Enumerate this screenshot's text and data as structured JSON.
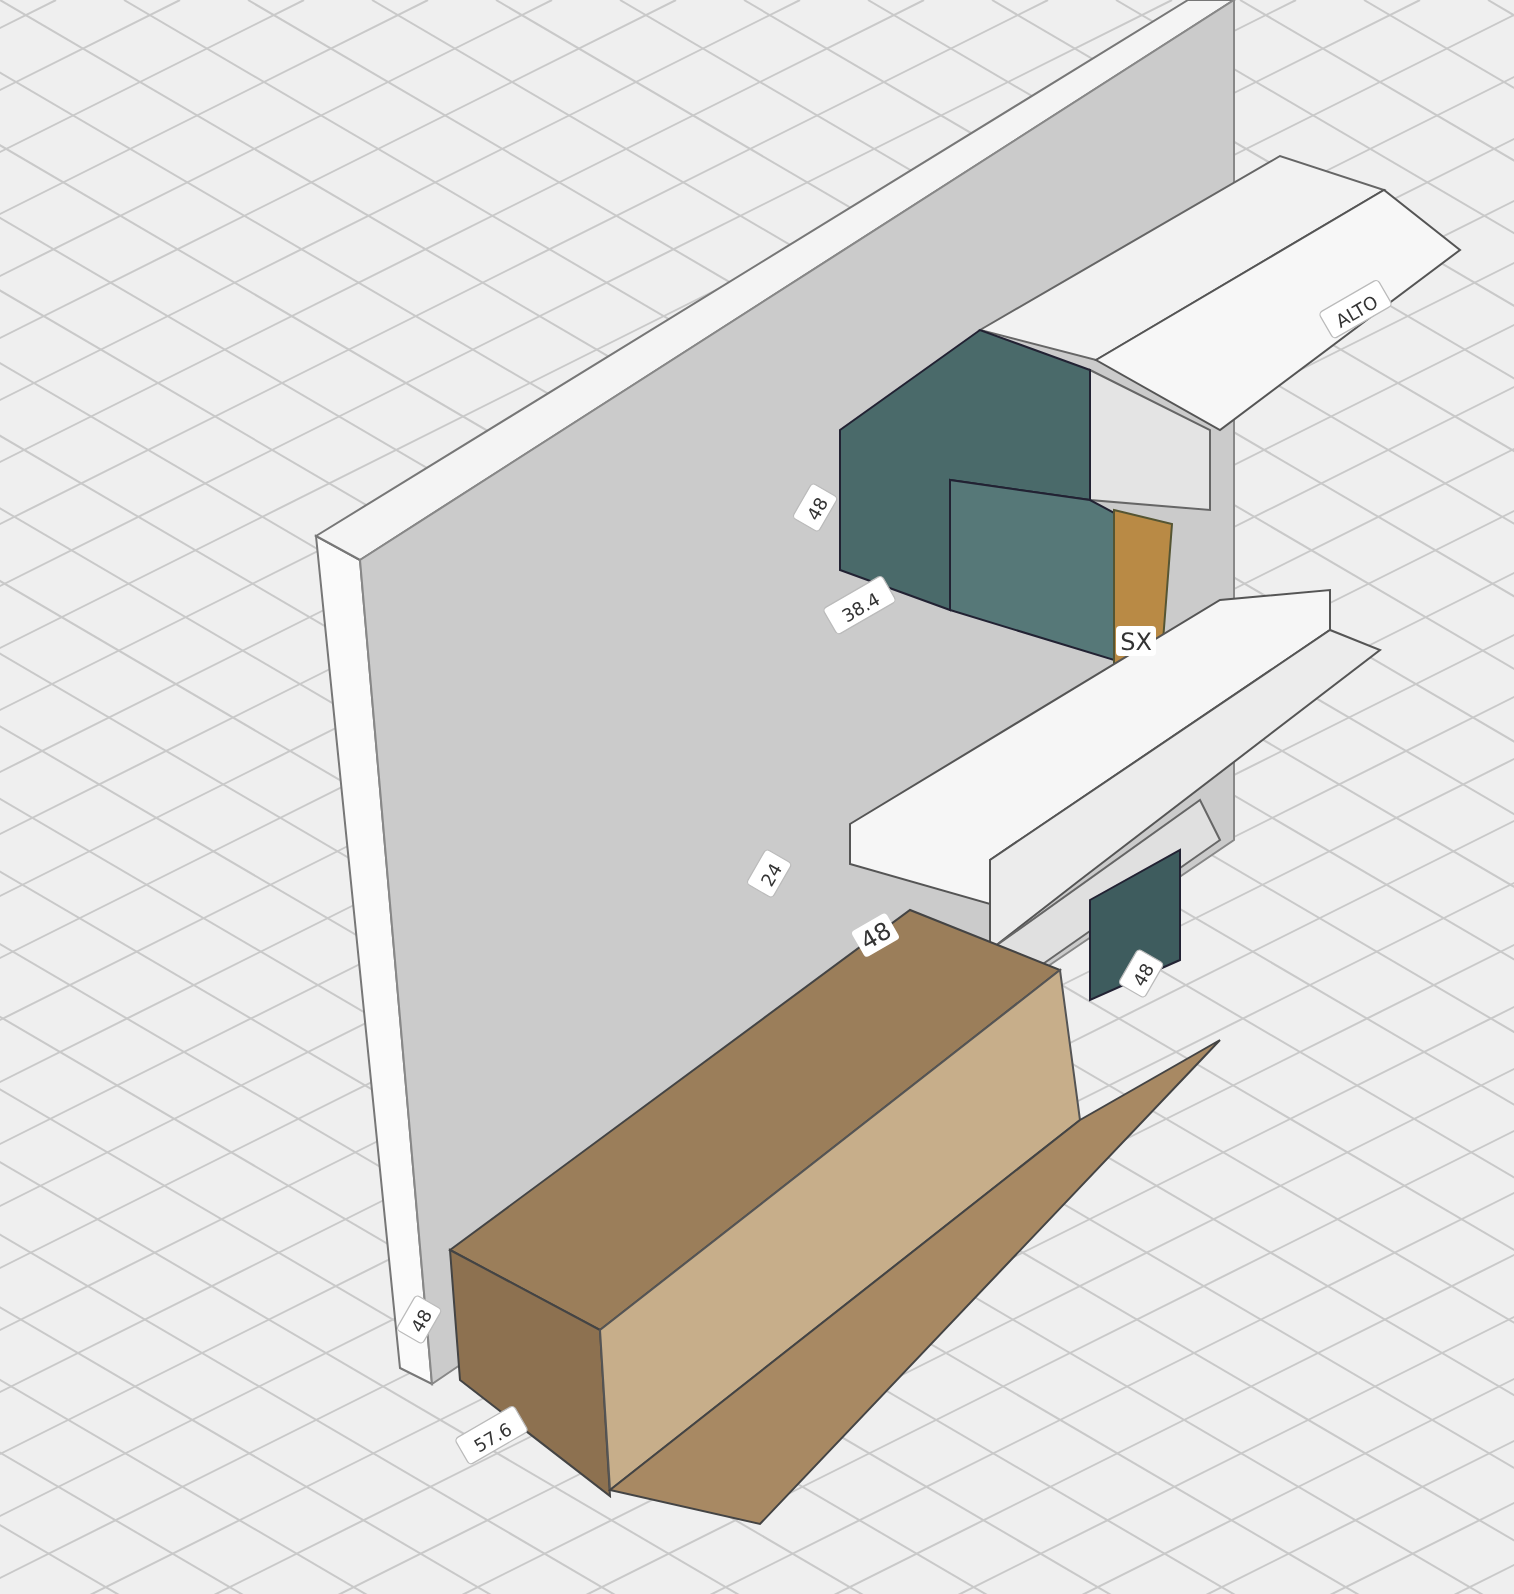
{
  "scene": {
    "labels": [
      {
        "kind": "dimension",
        "text": "48"
      },
      {
        "kind": "dimension",
        "text": "38.4"
      },
      {
        "kind": "dimension",
        "text": "ALTO"
      },
      {
        "kind": "tag",
        "text": "SX"
      },
      {
        "kind": "dimension",
        "text": "24"
      },
      {
        "kind": "tag",
        "text": "48"
      },
      {
        "kind": "dimension",
        "text": "48"
      },
      {
        "kind": "dimension",
        "text": "48"
      },
      {
        "kind": "dimension",
        "text": "57.6"
      }
    ]
  }
}
